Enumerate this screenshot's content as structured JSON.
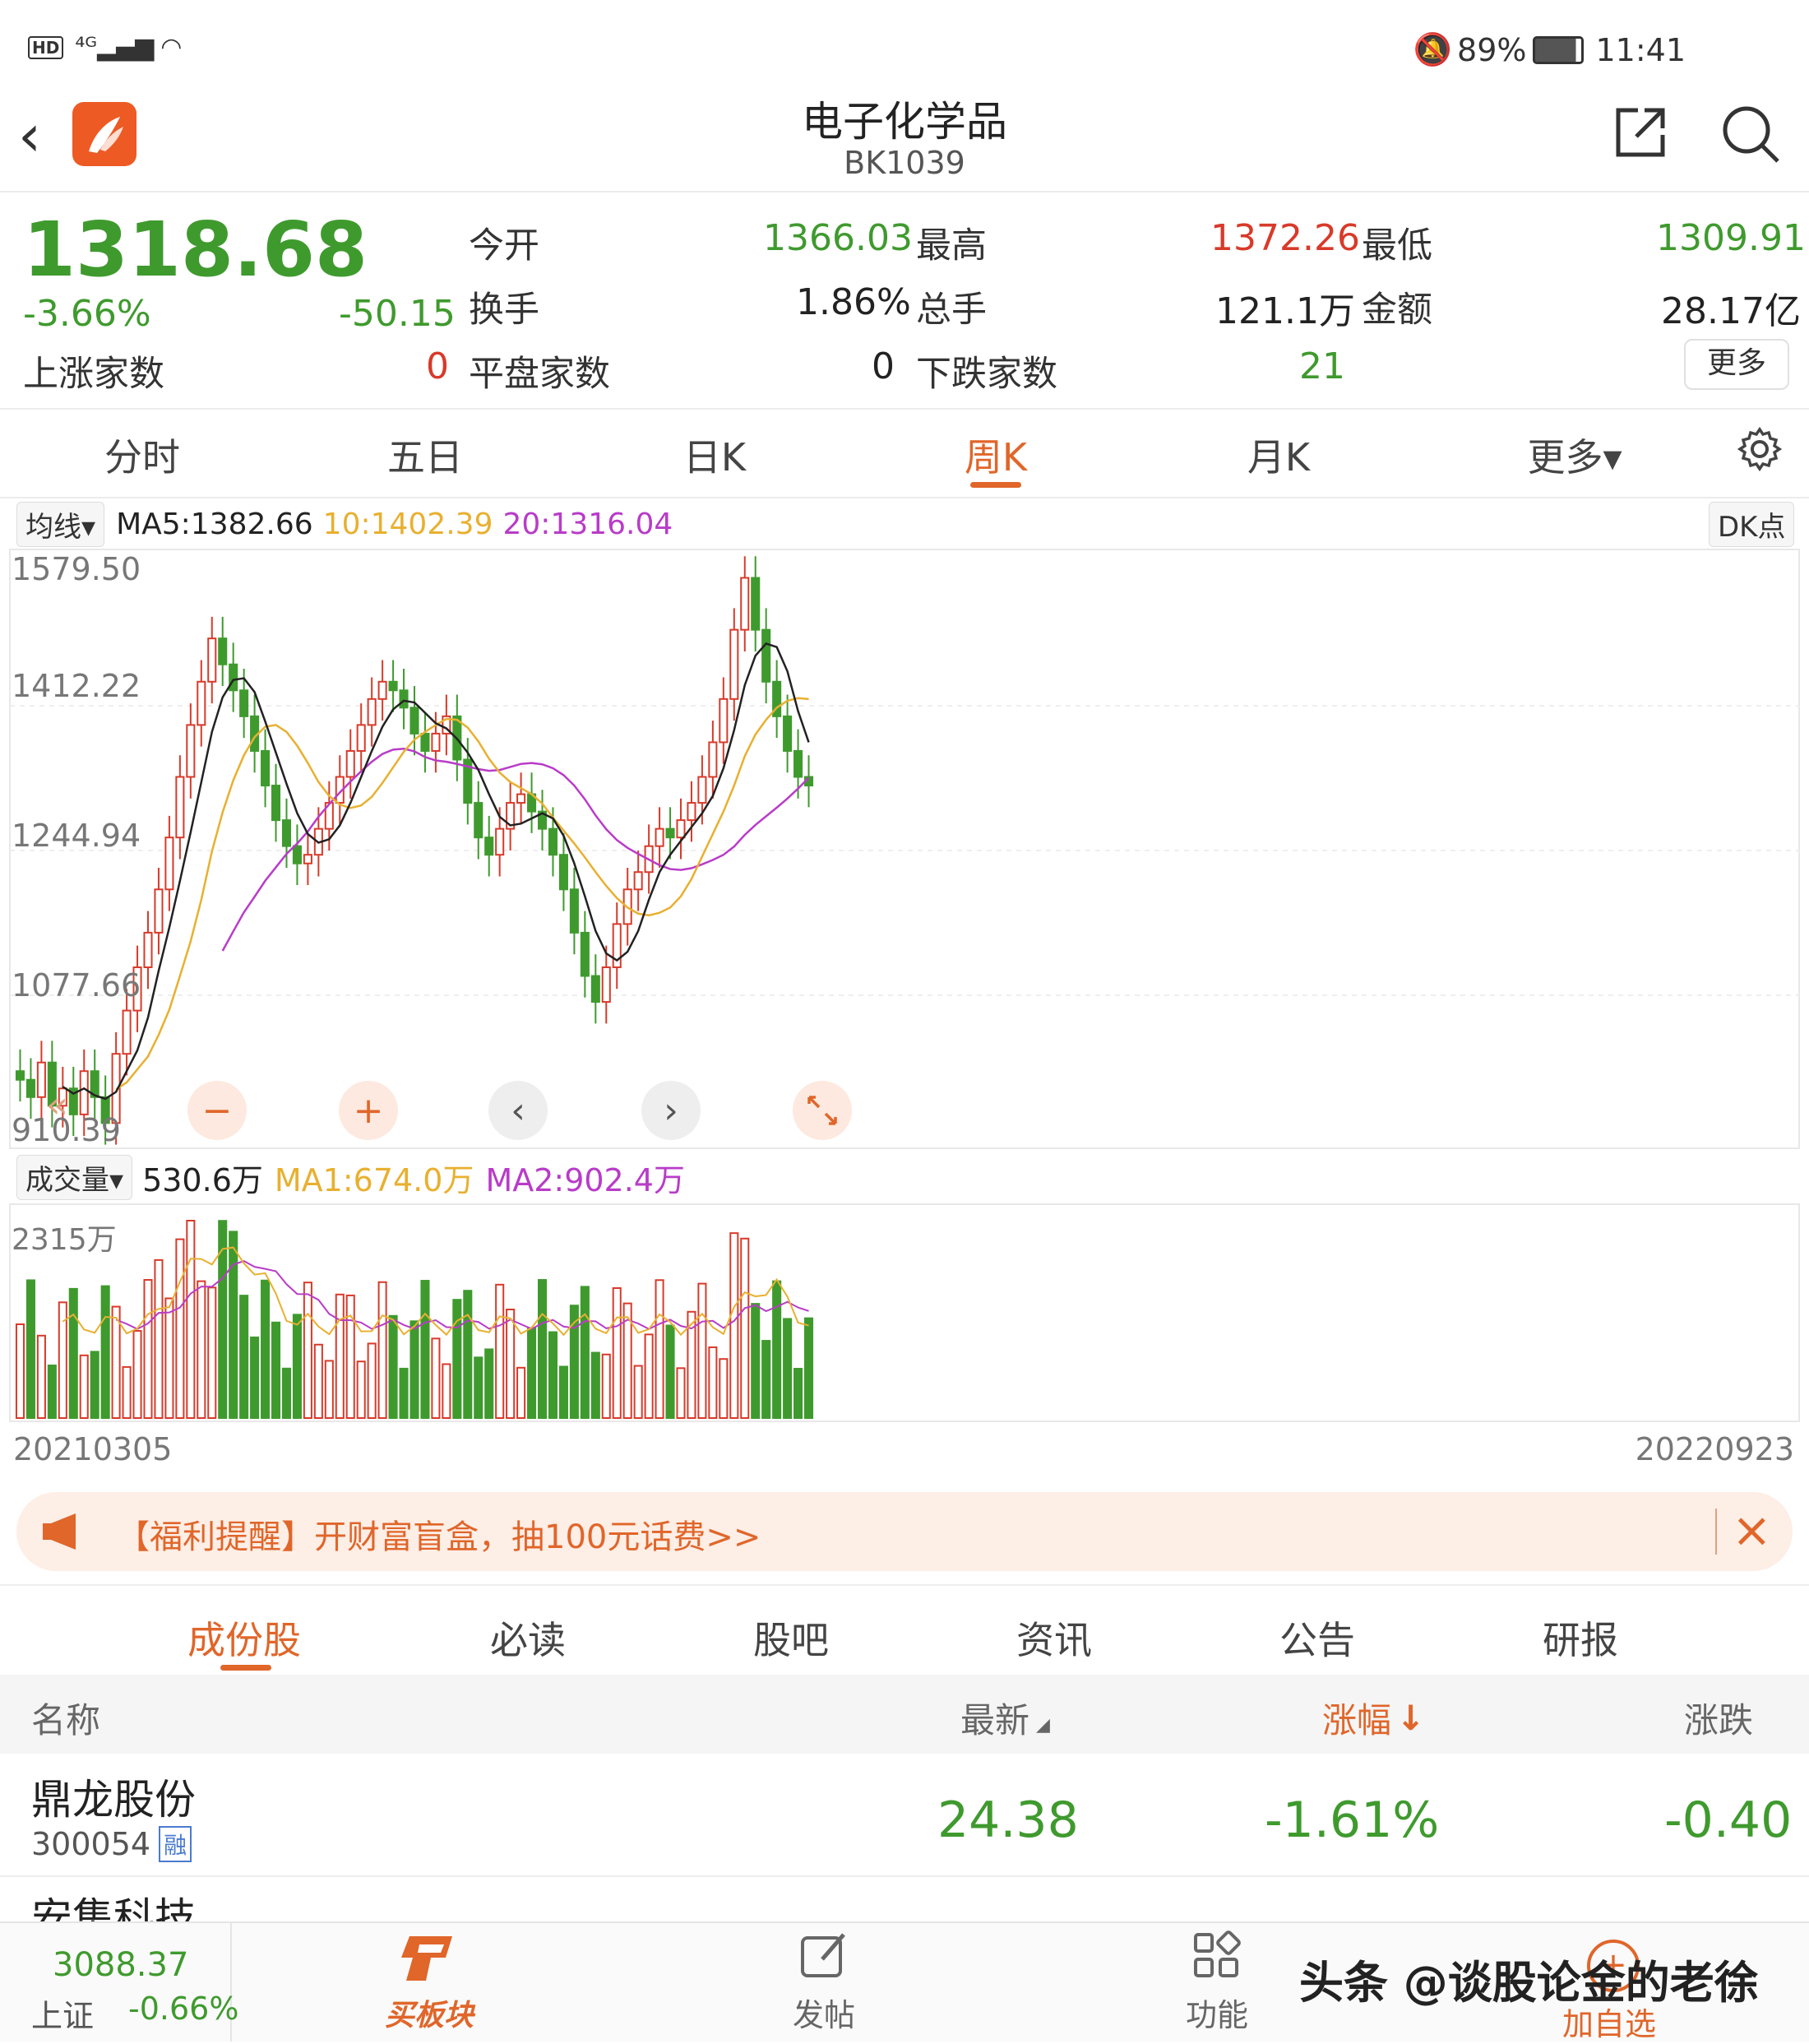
{
  "status": {
    "left_icons": "HD 4G signal wifi",
    "battery": "89%",
    "time": "11:41"
  },
  "header": {
    "title": "电子化学品",
    "code": "BK1039"
  },
  "quote": {
    "price": "1318.68",
    "pct": "-3.66%",
    "chg": "-50.15",
    "open_label": "今开",
    "open": "1366.03",
    "high_label": "最高",
    "high": "1372.26",
    "low_label": "最低",
    "low": "1309.91",
    "turnover_label": "换手",
    "turnover": "1.86%",
    "vol_label": "总手",
    "vol": "121.1万",
    "amount_label": "金额",
    "amount": "28.17亿",
    "up_label": "上涨家数",
    "up": "0",
    "flat_label": "平盘家数",
    "flat": "0",
    "down_label": "下跌家数",
    "down": "21",
    "more": "更多"
  },
  "tabs": [
    "分时",
    "五日",
    "日K",
    "周K",
    "月K",
    "更多▾"
  ],
  "ma": {
    "selector": "均线▾",
    "ma5": "MA5:1382.66",
    "ma10": "10:1402.39",
    "ma20": "20:1316.04",
    "dk": "DK点"
  },
  "price_axis": [
    "1579.50",
    "1412.22",
    "1244.94",
    "1077.66",
    "910.39"
  ],
  "vol_bar": {
    "selector": "成交量▾",
    "value": "530.6万",
    "ma1": "MA1:674.0万",
    "ma2": "MA2:902.4万",
    "max": "2315万"
  },
  "dates": {
    "start": "20210305",
    "end": "20220923"
  },
  "banner": {
    "text": "【福利提醒】开财富盲盒，抽100元话费>>"
  },
  "subtabs": [
    "成份股",
    "必读",
    "股吧",
    "资讯",
    "公告",
    "研报"
  ],
  "table": {
    "headers": {
      "name": "名称",
      "last": "最新",
      "pct": "涨幅",
      "chg": "涨跌"
    },
    "rows": [
      {
        "name": "鼎龙股份",
        "code": "300054",
        "tag": "融",
        "last": "24.38",
        "pct": "-1.61%",
        "chg": "-0.40"
      }
    ],
    "partial_row": "安集科技"
  },
  "bottom": {
    "index_value": "3088.37",
    "index_name": "上证",
    "index_pct": "-0.66%",
    "buy": "买板块",
    "post": "发帖",
    "func": "功能",
    "add": "加自选"
  },
  "watermark": "头条 @谈股论金的老徐",
  "colors": {
    "accent": "#e0662a",
    "up": "#d83a2a",
    "down": "#3f9a2e",
    "ma5": "#222222",
    "ma10": "#e8b030",
    "ma20": "#b83cc8"
  }
}
